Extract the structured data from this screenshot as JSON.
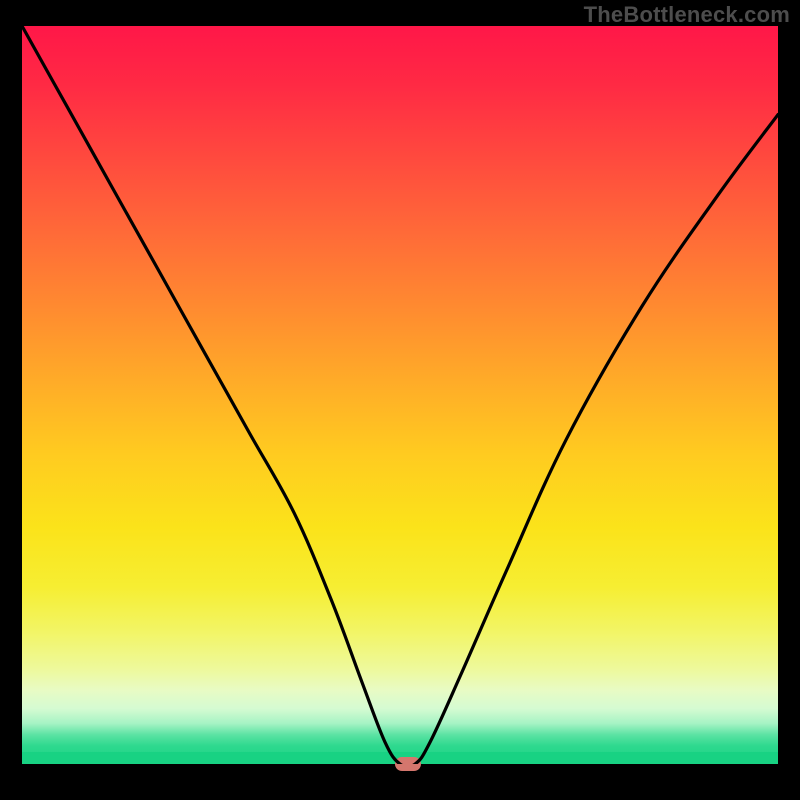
{
  "watermark": "TheBottleneck.com",
  "chart_data": {
    "type": "line",
    "title": "",
    "xlabel": "",
    "ylabel": "",
    "xlim": [
      0,
      100
    ],
    "ylim": [
      0,
      100
    ],
    "grid": false,
    "legend": false,
    "background": "rainbow-gradient-red-to-green",
    "series": [
      {
        "name": "bottleneck-curve",
        "x": [
          0,
          6,
          12,
          18,
          24,
          30,
          36,
          41,
          45,
          48,
          50,
          52,
          54,
          58,
          64,
          72,
          82,
          92,
          100
        ],
        "values": [
          100,
          89,
          78,
          67,
          56,
          45,
          34,
          22,
          11,
          3,
          0,
          0,
          3,
          12,
          26,
          44,
          62,
          77,
          88
        ]
      }
    ],
    "marker": {
      "name": "minimum-point",
      "x": 51,
      "y": 0,
      "color": "#d4766d",
      "shape": "rounded-rect"
    }
  }
}
